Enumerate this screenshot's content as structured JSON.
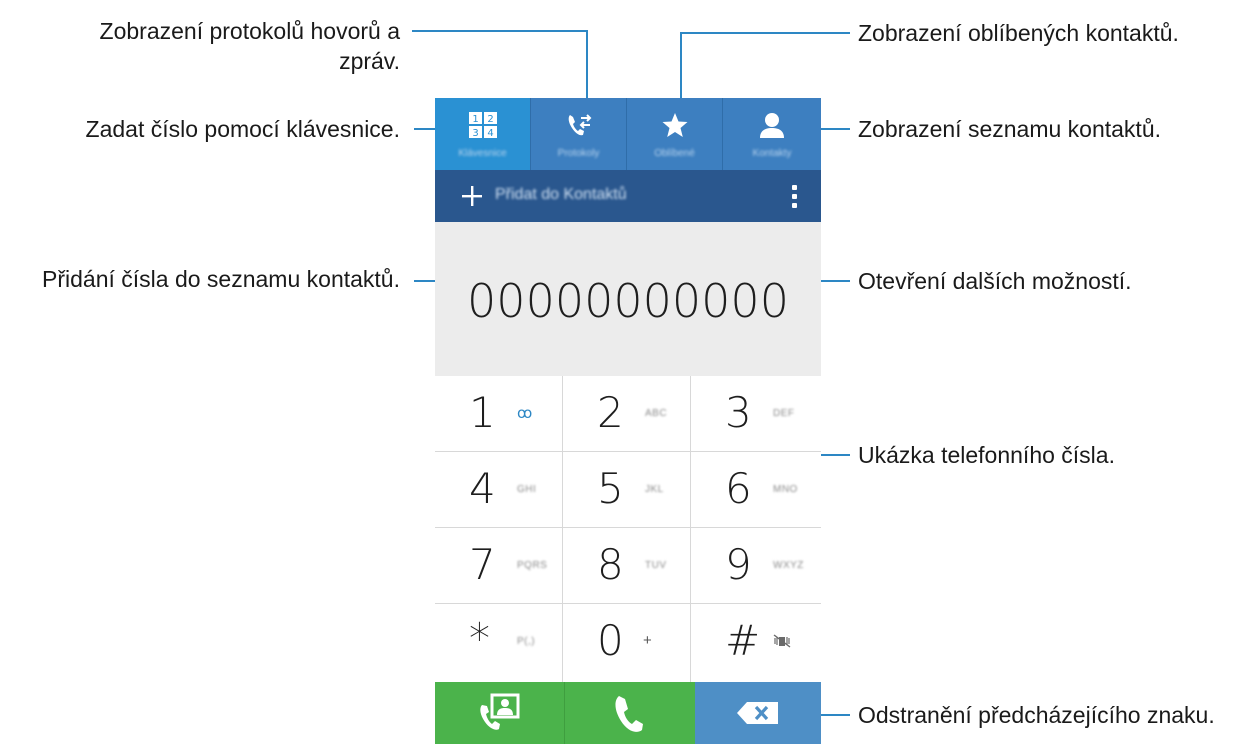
{
  "annotations": {
    "logs": {
      "line1": "Zobrazení protokolů hovorů a",
      "line2": "zpráv."
    },
    "favorites": "Zobrazení oblíbených kontaktů.",
    "keypad": "Zadat číslo pomocí klávesnice.",
    "contacts": "Zobrazení seznamu kontaktů.",
    "add_contact": "Přidání čísla do seznamu kontaktů.",
    "more_options": "Otevření dalších možností.",
    "number_preview": "Ukázka telefonního čísla.",
    "delete": "Odstranění předcházejícího znaku."
  },
  "tabs": [
    {
      "label": "Klávesnice",
      "icon": "keypad-icon",
      "active": true
    },
    {
      "label": "Protokoly",
      "icon": "call-log-icon",
      "active": false
    },
    {
      "label": "Oblíbené",
      "icon": "star-icon",
      "active": false
    },
    {
      "label": "Kontakty",
      "icon": "person-icon",
      "active": false
    }
  ],
  "actionbar": {
    "add_label": "Přidat do Kontaktů"
  },
  "display": {
    "number": "00000000000"
  },
  "keys": [
    {
      "digit": "1",
      "sub": "ꝏ"
    },
    {
      "digit": "2",
      "sub": "ABC"
    },
    {
      "digit": "3",
      "sub": "DEF"
    },
    {
      "digit": "4",
      "sub": "GHI"
    },
    {
      "digit": "5",
      "sub": "JKL"
    },
    {
      "digit": "6",
      "sub": "MNO"
    },
    {
      "digit": "7",
      "sub": "PQRS"
    },
    {
      "digit": "8",
      "sub": "TUV"
    },
    {
      "digit": "9",
      "sub": "WXYZ"
    },
    {
      "digit": "*",
      "sub": "P(,)"
    },
    {
      "digit": "0",
      "sub": "+"
    },
    {
      "digit": "#",
      "sub": ""
    }
  ],
  "colors": {
    "accent": "#2d87c4",
    "tab_bar": "#3d7fc0",
    "tab_active": "#2a91d3",
    "action_bar": "#2a578e",
    "green": "#4bb34b",
    "delete_blue": "#4e8fc6"
  }
}
